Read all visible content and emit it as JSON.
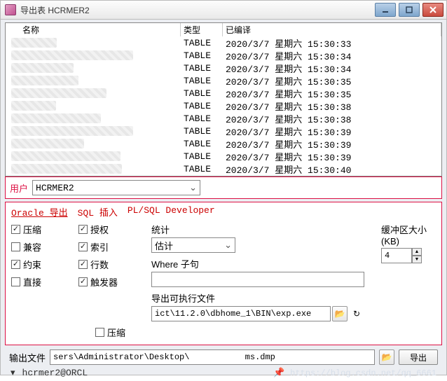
{
  "window": {
    "title": "导出表 HCRMER2"
  },
  "grid": {
    "headers": {
      "name": "名称",
      "type": "类型",
      "compiled": "已编译"
    },
    "rows": [
      {
        "type": "TABLE",
        "compiled": "2020/3/7 星期六 15:30:33"
      },
      {
        "type": "TABLE",
        "compiled": "2020/3/7 星期六 15:30:34"
      },
      {
        "type": "TABLE",
        "compiled": "2020/3/7 星期六 15:30:34"
      },
      {
        "type": "TABLE",
        "compiled": "2020/3/7 星期六 15:30:35"
      },
      {
        "type": "TABLE",
        "compiled": "2020/3/7 星期六 15:30:35"
      },
      {
        "type": "TABLE",
        "compiled": "2020/3/7 星期六 15:30:38"
      },
      {
        "type": "TABLE",
        "compiled": "2020/3/7 星期六 15:30:38"
      },
      {
        "type": "TABLE",
        "compiled": "2020/3/7 星期六 15:30:39"
      },
      {
        "type": "TABLE",
        "compiled": "2020/3/7 星期六 15:30:39"
      },
      {
        "type": "TABLE",
        "compiled": "2020/3/7 星期六 15:30:39"
      },
      {
        "type": "TABLE",
        "compiled": "2020/3/7 星期六 15:30:40"
      }
    ]
  },
  "user": {
    "label": "用户",
    "value": "HCRMER2"
  },
  "tabs": {
    "oracle": "Oracle 导出",
    "sql": "SQL 插入",
    "plsql": "PL/SQL Developer"
  },
  "opts": {
    "compress": "压缩",
    "compat": "兼容",
    "constraint": "约束",
    "direct": "直接",
    "grants": "授权",
    "indexes": "索引",
    "rows": "行数",
    "triggers": "触发器",
    "compress2": "压缩"
  },
  "stats": {
    "label": "统计",
    "value": "估计"
  },
  "buffer": {
    "label": "缓冲区大小(KB)",
    "value": "4"
  },
  "where": {
    "label": "Where 子句",
    "value": ""
  },
  "exec": {
    "label": "导出可执行文件",
    "value": "ict\\11.2.0\\dbhome_1\\BIN\\exp.exe"
  },
  "output": {
    "label": "输出文件",
    "value": "sers\\Administrator\\Desktop\\           ms.dmp"
  },
  "export_btn": "导出",
  "status": {
    "conn": "hcrmer2@ORCL",
    "watermark": "https://blog.csdn.net/qq_6661"
  }
}
